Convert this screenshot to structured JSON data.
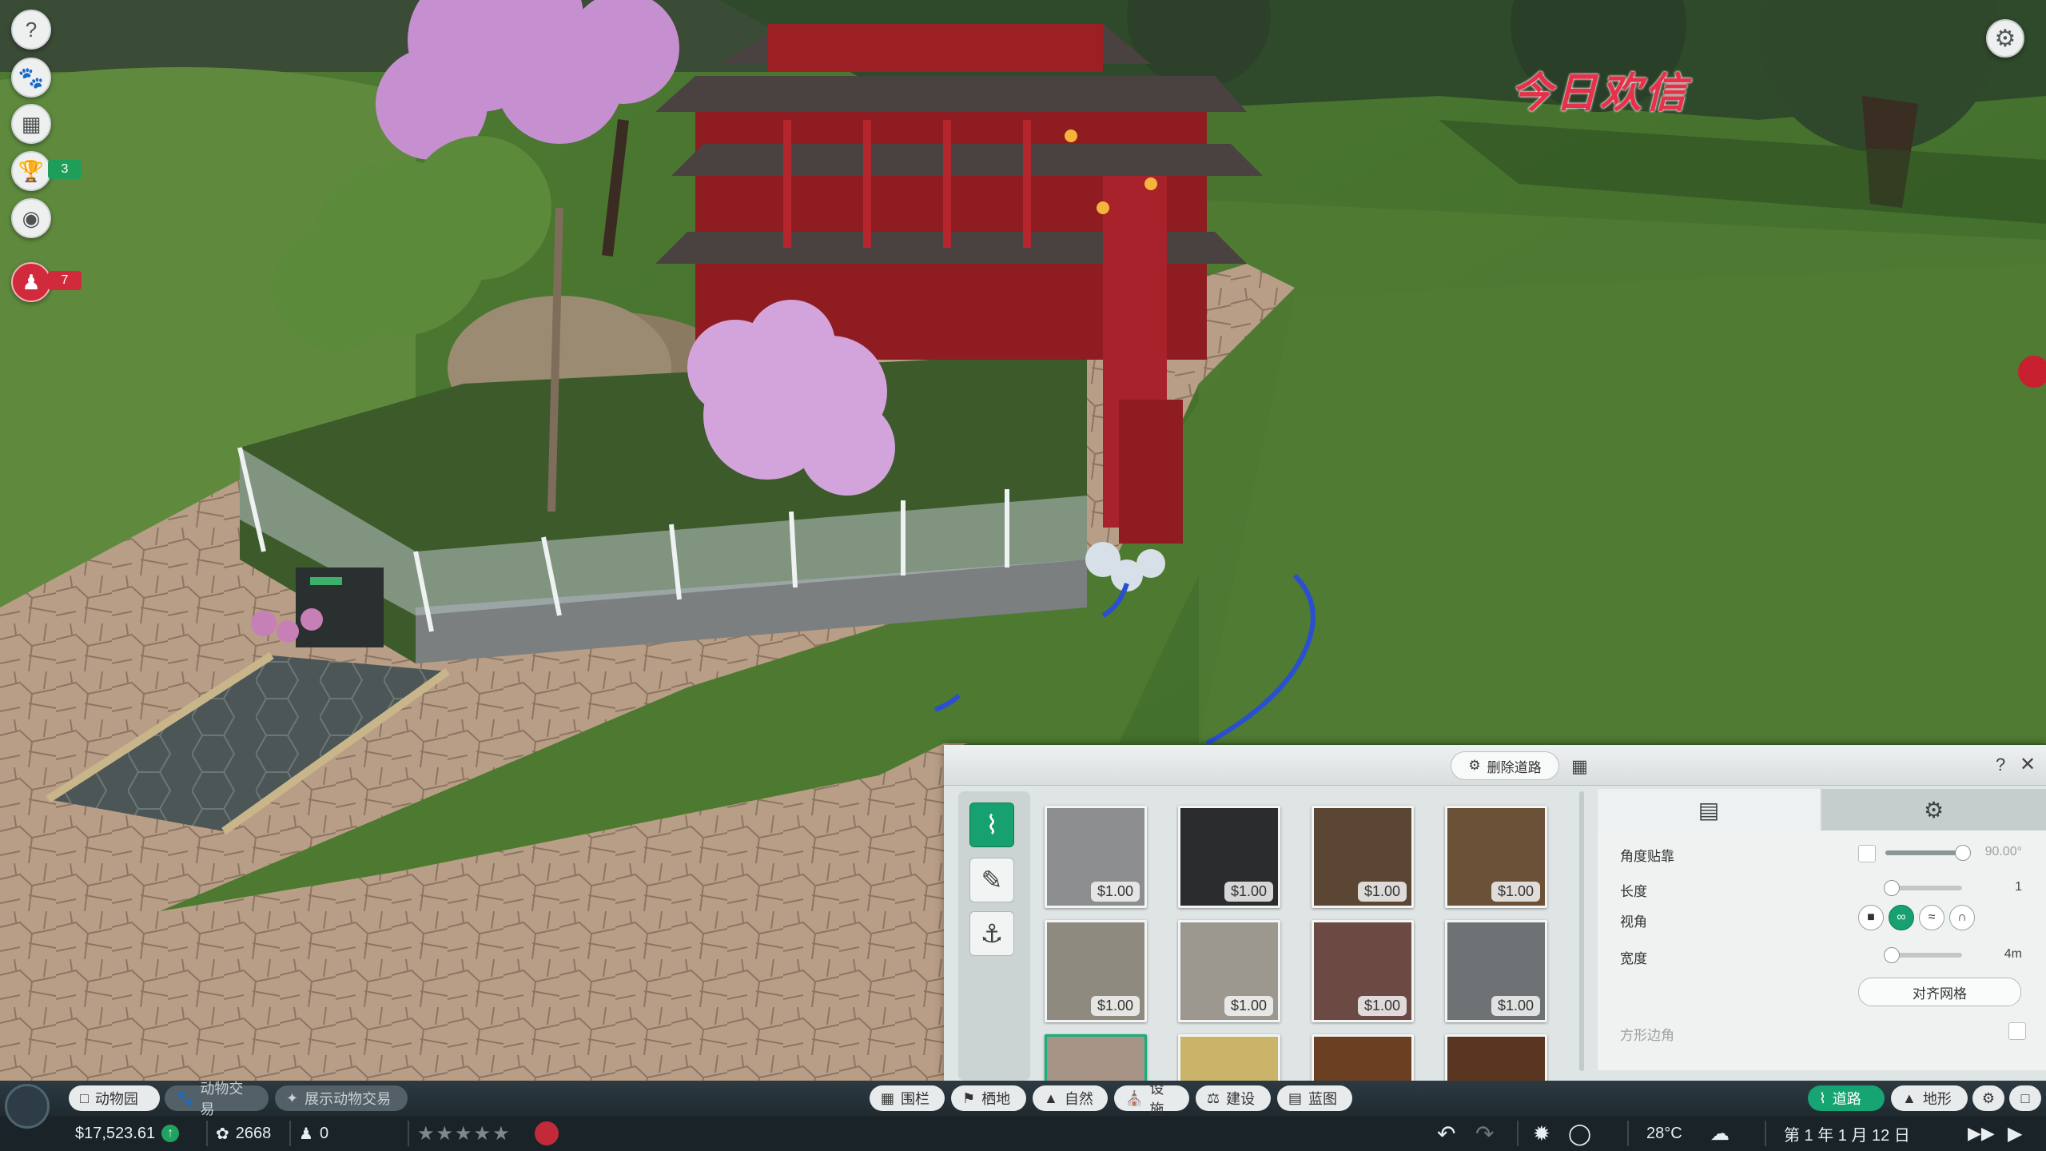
{
  "watermark": "今日欢信",
  "left_menu": {
    "help_icon": "help-icon",
    "zoo_icon": "paw-icon",
    "calendar_icon": "calendar-icon",
    "awards_icon": "trophy-icon",
    "awards_count": "3",
    "visibility_icon": "eye-icon",
    "staff_icon": "staff-icon",
    "staff_count": "7"
  },
  "path_panel": {
    "delete_label": "删除道路",
    "help": "?",
    "close": "✕",
    "materials": [
      {
        "price": "$1.00",
        "color": "#8c8d8e"
      },
      {
        "price": "$1.00",
        "color": "#2a2c2e"
      },
      {
        "price": "$1.00",
        "color": "#5a4632"
      },
      {
        "price": "$1.00",
        "color": "#6b5138"
      },
      {
        "price": "$1.00",
        "color": "#8f8a80"
      },
      {
        "price": "$1.00",
        "color": "#9c9890"
      },
      {
        "price": "$1.00",
        "color": "#6c4a44"
      },
      {
        "price": "$1.00",
        "color": "#6e7274"
      },
      {
        "price": "",
        "color": "#a89486"
      },
      {
        "price": "",
        "color": "#c9b46a"
      },
      {
        "price": "",
        "color": "#6a3f22"
      },
      {
        "price": "",
        "color": "#5a3622"
      }
    ],
    "props": {
      "angle_snap_label": "角度贴靠",
      "angle_value": "90.00°",
      "angle_fraction": 1.0,
      "length_label": "长度",
      "length_value": "1",
      "view_label": "视角",
      "width_label": "宽度",
      "width_value": "4m",
      "align_grid_label": "对齐网格",
      "square_corner_label": "方形边角"
    }
  },
  "bottom_bar": {
    "zoo_tab": "动物园",
    "animal_trade_tab": "动物交易",
    "exhibit_trade_tab": "展示动物交易",
    "tools": [
      "围栏",
      "栖地",
      "自然",
      "设施",
      "建设",
      "蓝图"
    ],
    "path_btn": "道路",
    "terrain_btn": "地形"
  },
  "status_bar": {
    "money": "$17,523.61",
    "conservation": "2668",
    "guests": "0",
    "rating_stars": 5,
    "temperature": "28°C",
    "date": "第 1 年 1 月 12 日"
  }
}
